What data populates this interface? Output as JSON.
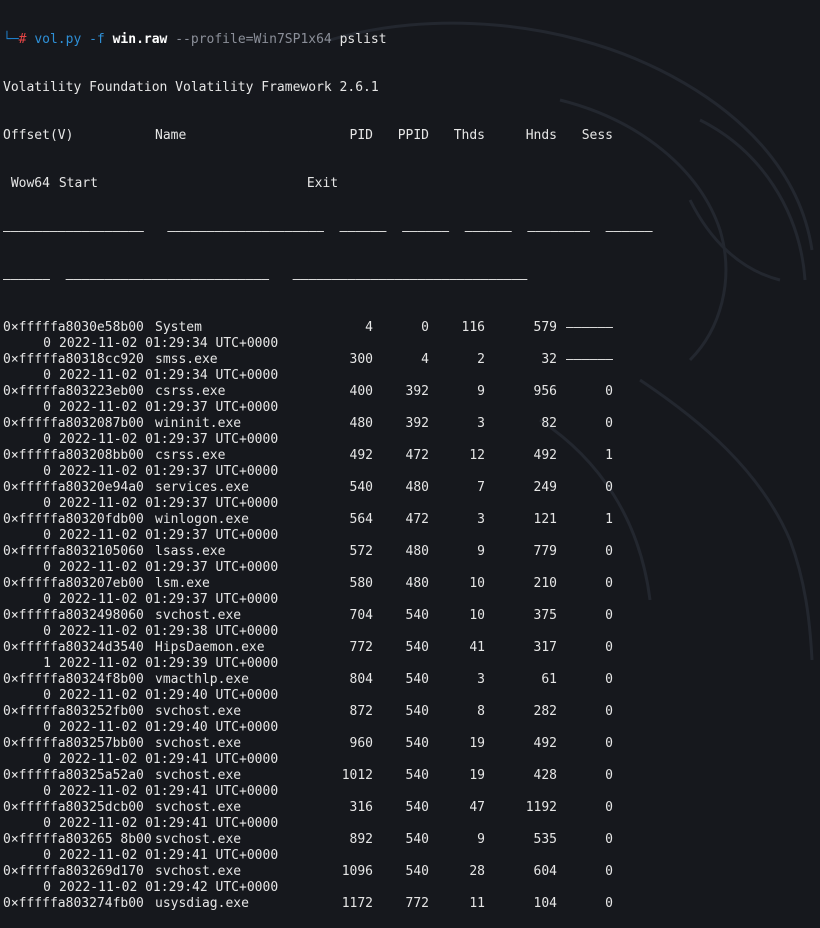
{
  "command": {
    "corner": "└─",
    "hash": "#",
    "script": "vol.py",
    "flag_f": "-f",
    "file": "win.raw",
    "profile": "--profile=Win7SP1x64",
    "plugin": "pslist"
  },
  "banner": "Volatility Foundation Volatility Framework 2.6.1",
  "headers": {
    "offset": "Offset(V)",
    "name": "Name",
    "pid": "PID",
    "ppid": "PPID",
    "thds": "Thds",
    "hnds": "Hnds",
    "sess": "Sess",
    "wow": " Wow64",
    "start": "Start",
    "exit": "Exit"
  },
  "separator_line1": "——————————————————   ————————————————————  ——————  ——————  ——————  ————————  ——————",
  "separator_line2": "——————  ——————————————————————————   ——————————————————————————————",
  "processes": [
    {
      "offset": "0×fffffa8030e58b00",
      "name": "System",
      "pid": "4",
      "ppid": "0",
      "thds": "116",
      "hnds": "579",
      "sess": "——————",
      "wow": "0",
      "start": "2022-11-02 01:29:34 UTC+0000"
    },
    {
      "offset": "0×fffffa80318cc920",
      "name": "smss.exe",
      "pid": "300",
      "ppid": "4",
      "thds": "2",
      "hnds": "32",
      "sess": "——————",
      "wow": "0",
      "start": "2022-11-02 01:29:34 UTC+0000"
    },
    {
      "offset": "0×fffffa803223eb00",
      "name": "csrss.exe",
      "pid": "400",
      "ppid": "392",
      "thds": "9",
      "hnds": "956",
      "sess": "0",
      "wow": "0",
      "start": "2022-11-02 01:29:37 UTC+0000"
    },
    {
      "offset": "0×fffffa8032087b00",
      "name": "wininit.exe",
      "pid": "480",
      "ppid": "392",
      "thds": "3",
      "hnds": "82",
      "sess": "0",
      "wow": "0",
      "start": "2022-11-02 01:29:37 UTC+0000"
    },
    {
      "offset": "0×fffffa803208bb00",
      "name": "csrss.exe",
      "pid": "492",
      "ppid": "472",
      "thds": "12",
      "hnds": "492",
      "sess": "1",
      "wow": "0",
      "start": "2022-11-02 01:29:37 UTC+0000"
    },
    {
      "offset": "0×fffffa80320e94a0",
      "name": "services.exe",
      "pid": "540",
      "ppid": "480",
      "thds": "7",
      "hnds": "249",
      "sess": "0",
      "wow": "0",
      "start": "2022-11-02 01:29:37 UTC+0000"
    },
    {
      "offset": "0×fffffa80320fdb00",
      "name": "winlogon.exe",
      "pid": "564",
      "ppid": "472",
      "thds": "3",
      "hnds": "121",
      "sess": "1",
      "wow": "0",
      "start": "2022-11-02 01:29:37 UTC+0000"
    },
    {
      "offset": "0×fffffa8032105060",
      "name": "lsass.exe",
      "pid": "572",
      "ppid": "480",
      "thds": "9",
      "hnds": "779",
      "sess": "0",
      "wow": "0",
      "start": "2022-11-02 01:29:37 UTC+0000"
    },
    {
      "offset": "0×fffffa803207eb00",
      "name": "lsm.exe",
      "pid": "580",
      "ppid": "480",
      "thds": "10",
      "hnds": "210",
      "sess": "0",
      "wow": "0",
      "start": "2022-11-02 01:29:37 UTC+0000"
    },
    {
      "offset": "0×fffffa8032498060",
      "name": "svchost.exe",
      "pid": "704",
      "ppid": "540",
      "thds": "10",
      "hnds": "375",
      "sess": "0",
      "wow": "0",
      "start": "2022-11-02 01:29:38 UTC+0000"
    },
    {
      "offset": "0×fffffa80324d3540",
      "name": "HipsDaemon.exe",
      "pid": "772",
      "ppid": "540",
      "thds": "41",
      "hnds": "317",
      "sess": "0",
      "wow": "1",
      "start": "2022-11-02 01:29:39 UTC+0000"
    },
    {
      "offset": "0×fffffa80324f8b00",
      "name": "vmacthlp.exe",
      "pid": "804",
      "ppid": "540",
      "thds": "3",
      "hnds": "61",
      "sess": "0",
      "wow": "0",
      "start": "2022-11-02 01:29:40 UTC+0000"
    },
    {
      "offset": "0×fffffa803252fb00",
      "name": "svchost.exe",
      "pid": "872",
      "ppid": "540",
      "thds": "8",
      "hnds": "282",
      "sess": "0",
      "wow": "0",
      "start": "2022-11-02 01:29:40 UTC+0000"
    },
    {
      "offset": "0×fffffa803257bb00",
      "name": "svchost.exe",
      "pid": "960",
      "ppid": "540",
      "thds": "19",
      "hnds": "492",
      "sess": "0",
      "wow": "0",
      "start": "2022-11-02 01:29:41 UTC+0000"
    },
    {
      "offset": "0×fffffa80325a52a0",
      "name": "svchost.exe",
      "pid": "1012",
      "ppid": "540",
      "thds": "19",
      "hnds": "428",
      "sess": "0",
      "wow": "0",
      "start": "2022-11-02 01:29:41 UTC+0000"
    },
    {
      "offset": "0×fffffa80325dcb00",
      "name": "svchost.exe",
      "pid": "316",
      "ppid": "540",
      "thds": "47",
      "hnds": "1192",
      "sess": "0",
      "wow": "0",
      "start": "2022-11-02 01:29:41 UTC+0000"
    },
    {
      "offset": "0×fffffa803265 8b00",
      "name": "svchost.exe",
      "pid": "892",
      "ppid": "540",
      "thds": "9",
      "hnds": "535",
      "sess": "0",
      "wow": "0",
      "start": "2022-11-02 01:29:41 UTC+0000"
    },
    {
      "offset": "0×fffffa803269d170",
      "name": "svchost.exe",
      "pid": "1096",
      "ppid": "540",
      "thds": "28",
      "hnds": "604",
      "sess": "0",
      "wow": "0",
      "start": "2022-11-02 01:29:42 UTC+0000"
    },
    {
      "offset": "0×fffffa803274fb00",
      "name": "usysdiag.exe",
      "pid": "1172",
      "ppid": "772",
      "thds": "11",
      "hnds": "104",
      "sess": "0"
    }
  ]
}
